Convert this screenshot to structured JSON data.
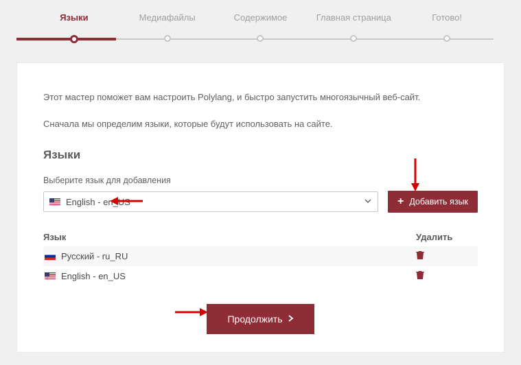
{
  "stepper": {
    "steps": [
      {
        "label": "Языки",
        "active": true
      },
      {
        "label": "Медиафайлы",
        "active": false
      },
      {
        "label": "Содержимое",
        "active": false
      },
      {
        "label": "Главная страница",
        "active": false
      },
      {
        "label": "Готово!",
        "active": false
      }
    ]
  },
  "intro": {
    "line1": "Этот мастер поможет вам настроить Polylang, и быстро запустить многоязычный веб-сайт.",
    "line2": "Сначала мы определим языки, которые будут использовать на сайте."
  },
  "section": {
    "title": "Языки",
    "select_label": "Выберите язык для добавления",
    "selected_value": "English - en_US",
    "add_button": "Добавить язык"
  },
  "table": {
    "col_language": "Язык",
    "col_delete": "Удалить",
    "rows": [
      {
        "flag": "ru",
        "label": "Русский - ru_RU"
      },
      {
        "flag": "us",
        "label": "English - en_US"
      }
    ]
  },
  "continue_label": "Продолжить"
}
